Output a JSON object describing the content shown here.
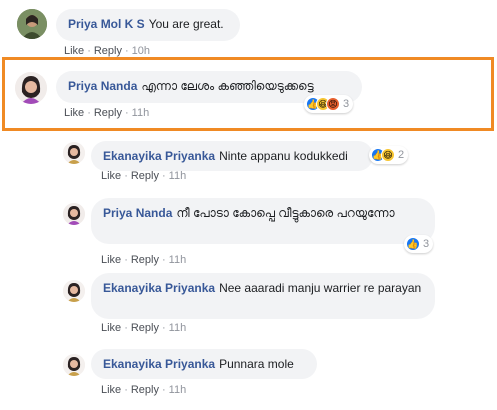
{
  "comments": [
    {
      "author": "Priya Mol K S",
      "text": "You are great.",
      "actions": {
        "like": "Like",
        "reply": "Reply",
        "time": "10h"
      }
    },
    {
      "author": "Priya Nanda",
      "text": "എന്നാ ലേശം കഞ്ഞിയെടുക്കട്ടെ",
      "actions": {
        "like": "Like",
        "reply": "Reply",
        "time": "11h"
      },
      "reactions": {
        "icons": [
          "like-icon",
          "haha-icon",
          "angry-icon"
        ],
        "count": "3"
      },
      "highlighted": true,
      "highlight_color": "#f08a24"
    }
  ],
  "replies": [
    {
      "author": "Ekanayika Priyanka",
      "text": "Ninte appanu kodukkedi",
      "actions": {
        "like": "Like",
        "reply": "Reply",
        "time": "11h"
      },
      "reactions": {
        "icons": [
          "like-icon",
          "haha-icon"
        ],
        "count": "2"
      }
    },
    {
      "author": "Priya Nanda",
      "text": "നീ പോടാ കോപ്പെ വീട്ടുകാരെ പറയുന്നോ",
      "actions": {
        "like": "Like",
        "reply": "Reply",
        "time": "11h"
      },
      "reactions": {
        "icons": [
          "like-icon"
        ],
        "count": "3"
      }
    },
    {
      "author": "Ekanayika Priyanka",
      "text": "Nee aaaradi manju warrier re parayan",
      "actions": {
        "like": "Like",
        "reply": "Reply",
        "time": "11h"
      }
    },
    {
      "author": "Ekanayika Priyanka",
      "text": "Punnara mole",
      "actions": {
        "like": "Like",
        "reply": "Reply",
        "time": "11h"
      }
    }
  ],
  "colors": {
    "author": "#385898",
    "bubble": "#f2f3f5",
    "like_blue": "#1877f2"
  }
}
